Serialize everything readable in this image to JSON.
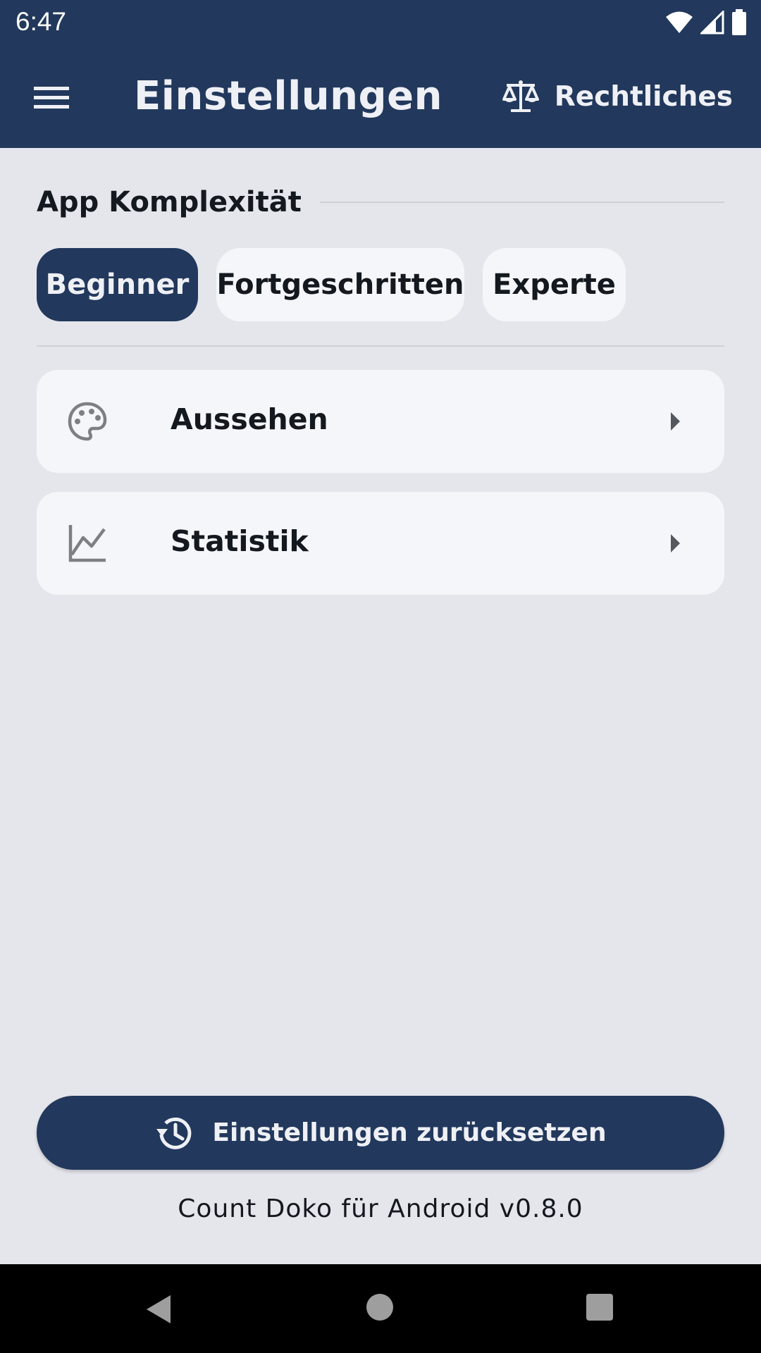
{
  "status_bar": {
    "time": "6:47",
    "icons": [
      "wifi-icon",
      "signal-icon",
      "battery-icon"
    ]
  },
  "app_bar": {
    "title": "Einstellungen",
    "menu_icon": "menu-icon",
    "legal_icon": "scale-icon",
    "legal_label": "Rechtliches"
  },
  "complexity": {
    "title": "App Komplexität",
    "options": [
      {
        "label": "Beginner",
        "selected": true
      },
      {
        "label": "Fortgeschritten",
        "selected": false
      },
      {
        "label": "Experte",
        "selected": false
      }
    ]
  },
  "settings_items": [
    {
      "label": "Aussehen",
      "icon": "palette-icon"
    },
    {
      "label": "Statistik",
      "icon": "chart-icon"
    }
  ],
  "reset_button": {
    "label": "Einstellungen zurücksetzen",
    "icon": "history-icon"
  },
  "footer": {
    "version": "Count Doko für Android v0.8.0"
  },
  "nav_bar": {
    "icons": [
      "back-icon",
      "home-icon",
      "recents-icon"
    ]
  },
  "colors": {
    "primary": "#22385c",
    "background": "#e5e6ec",
    "surface": "#f5f6f9",
    "text": "#14181f"
  }
}
